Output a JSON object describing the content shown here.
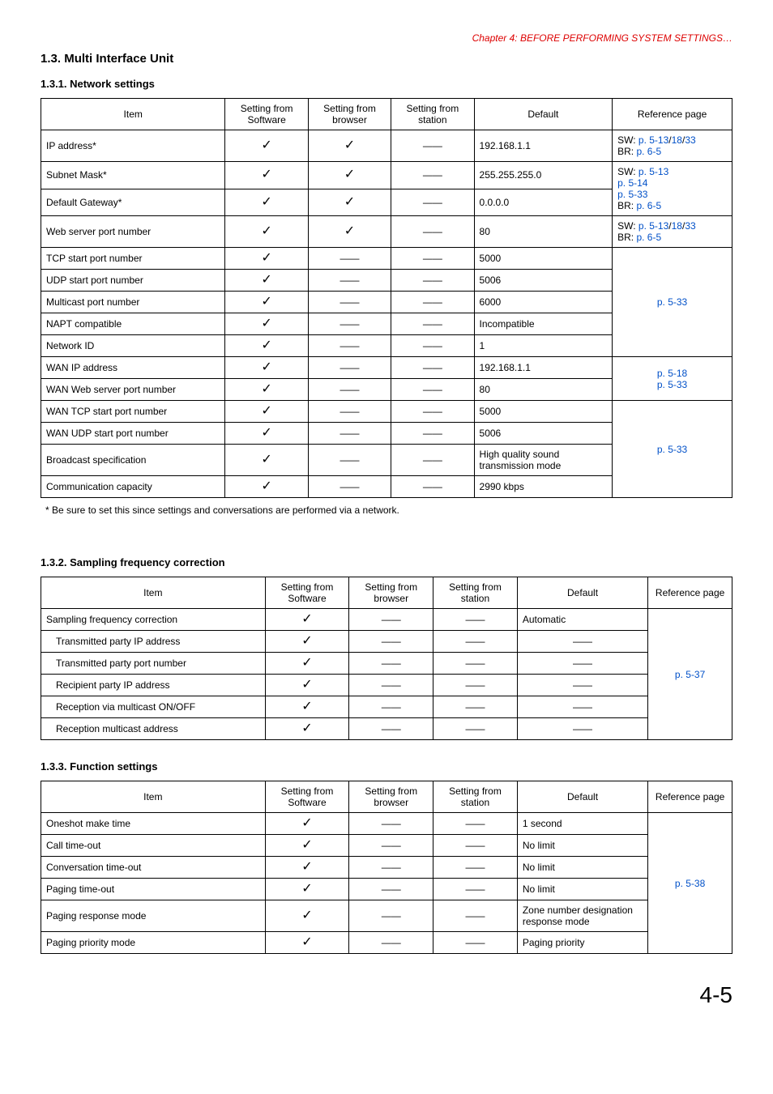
{
  "chapterHeader": "Chapter 4:  BEFORE PERFORMING SYSTEM SETTINGS…",
  "section": {
    "number": "1.3.",
    "title": "Multi Interface Unit"
  },
  "networkSettings": {
    "heading": "1.3.1. Network settings",
    "columns": [
      "Item",
      "Setting from Software",
      "Setting from browser",
      "Setting from station",
      "Default",
      "Reference page"
    ],
    "rows": [
      {
        "item": "IP address*",
        "sw": "✓",
        "br": "✓",
        "st": "——",
        "def": "192.168.1.1",
        "ref": [
          {
            "t": "SW: ",
            "l": false
          },
          {
            "t": "p. 5-13",
            "l": true
          },
          {
            "t": "/",
            "l": false
          },
          {
            "t": "18",
            "l": true
          },
          {
            "t": "/",
            "l": false
          },
          {
            "t": "33",
            "l": true
          },
          {
            "t": "\nBR:  ",
            "l": false
          },
          {
            "t": "p. 6-5",
            "l": true
          }
        ],
        "refRowspan": 1
      },
      {
        "item": "Subnet Mask*",
        "sw": "✓",
        "br": "✓",
        "st": "——",
        "def": "255.255.255.0",
        "ref": [
          {
            "t": "SW: ",
            "l": false
          },
          {
            "t": "p. 5-13",
            "l": true
          },
          {
            "t": "\n",
            "l": false
          },
          {
            "t": "p. 5-14",
            "l": true
          },
          {
            "t": "\n",
            "l": false
          },
          {
            "t": "p. 5-33",
            "l": true
          },
          {
            "t": "\nBR:  ",
            "l": false
          },
          {
            "t": "p. 6-5",
            "l": true
          }
        ],
        "refRowspan": 2
      },
      {
        "item": "Default Gateway*",
        "sw": "✓",
        "br": "✓",
        "st": "——",
        "def": "0.0.0.0"
      },
      {
        "item": "Web server port number",
        "sw": "✓",
        "br": "✓",
        "st": "——",
        "def": "80",
        "ref": [
          {
            "t": "SW: ",
            "l": false
          },
          {
            "t": "p. 5-13",
            "l": true
          },
          {
            "t": "/",
            "l": false
          },
          {
            "t": "18",
            "l": true
          },
          {
            "t": "/",
            "l": false
          },
          {
            "t": "33",
            "l": true
          },
          {
            "t": "\nBR:  ",
            "l": false
          },
          {
            "t": "p. 6-5",
            "l": true
          }
        ],
        "refRowspan": 1
      },
      {
        "item": "TCP start port number",
        "sw": "✓",
        "br": "——",
        "st": "——",
        "def": "5000",
        "ref": [
          {
            "t": "p. 5-33",
            "l": true
          }
        ],
        "refRowspan": 5,
        "refCenter": true
      },
      {
        "item": "UDP start port number",
        "sw": "✓",
        "br": "——",
        "st": "——",
        "def": "5006"
      },
      {
        "item": "Multicast port number",
        "sw": "✓",
        "br": "——",
        "st": "——",
        "def": "6000"
      },
      {
        "item": "NAPT compatible",
        "sw": "✓",
        "br": "——",
        "st": "——",
        "def": "Incompatible"
      },
      {
        "item": "Network ID",
        "sw": "✓",
        "br": "——",
        "st": "——",
        "def": "1"
      },
      {
        "item": "WAN IP address",
        "sw": "✓",
        "br": "——",
        "st": "——",
        "def": "192.168.1.1",
        "ref": [
          {
            "t": "p. 5-18",
            "l": true
          },
          {
            "t": "\n",
            "l": false
          },
          {
            "t": "p. 5-33",
            "l": true
          }
        ],
        "refRowspan": 2,
        "refCenter": true
      },
      {
        "item": "WAN Web server port number",
        "sw": "✓",
        "br": "——",
        "st": "——",
        "def": "80"
      },
      {
        "item": "WAN TCP start port number",
        "sw": "✓",
        "br": "——",
        "st": "——",
        "def": "5000",
        "ref": [
          {
            "t": "p. 5-33",
            "l": true
          }
        ],
        "refRowspan": 4,
        "refCenter": true
      },
      {
        "item": "WAN UDP start port number",
        "sw": "✓",
        "br": "——",
        "st": "——",
        "def": "5006"
      },
      {
        "item": "Broadcast specification",
        "sw": "✓",
        "br": "——",
        "st": "——",
        "def": "High quality sound transmission mode"
      },
      {
        "item": "Communication capacity",
        "sw": "✓",
        "br": "——",
        "st": "——",
        "def": "2990 kbps"
      }
    ],
    "footnote": "*  Be sure to set this since settings and conversations are performed via a network."
  },
  "samplingFreq": {
    "heading": "1.3.2. Sampling frequency correction",
    "columns": [
      "Item",
      "Setting from Software",
      "Setting from browser",
      "Setting from station",
      "Default",
      "Reference page"
    ],
    "rows": [
      {
        "item": "Sampling frequency correction",
        "sw": "✓",
        "br": "——",
        "st": "——",
        "def": "Automatic",
        "indent": false
      },
      {
        "item": "Transmitted party IP address",
        "sw": "✓",
        "br": "——",
        "st": "——",
        "def": "——",
        "indent": true
      },
      {
        "item": "Transmitted party port number",
        "sw": "✓",
        "br": "——",
        "st": "——",
        "def": "——",
        "indent": true
      },
      {
        "item": "Recipient party IP address",
        "sw": "✓",
        "br": "——",
        "st": "——",
        "def": "——",
        "indent": true
      },
      {
        "item": "Reception via multicast ON/OFF",
        "sw": "✓",
        "br": "——",
        "st": "——",
        "def": "——",
        "indent": true
      },
      {
        "item": "Reception multicast address",
        "sw": "✓",
        "br": "——",
        "st": "——",
        "def": "——",
        "indent": true
      }
    ],
    "refText": "p. 5-37"
  },
  "functionSettings": {
    "heading": "1.3.3. Function settings",
    "columns": [
      "Item",
      "Setting from Software",
      "Setting from browser",
      "Setting from station",
      "Default",
      "Reference page"
    ],
    "rows": [
      {
        "item": "Oneshot make time",
        "sw": "✓",
        "br": "——",
        "st": "——",
        "def": "1 second"
      },
      {
        "item": "Call time-out",
        "sw": "✓",
        "br": "——",
        "st": "——",
        "def": "No limit"
      },
      {
        "item": "Conversation time-out",
        "sw": "✓",
        "br": "——",
        "st": "——",
        "def": "No limit"
      },
      {
        "item": "Paging time-out",
        "sw": "✓",
        "br": "——",
        "st": "——",
        "def": "No limit"
      },
      {
        "item": "Paging response mode",
        "sw": "✓",
        "br": "——",
        "st": "——",
        "def": "Zone number designation response mode"
      },
      {
        "item": "Paging priority mode",
        "sw": "✓",
        "br": "——",
        "st": "——",
        "def": "Paging priority"
      }
    ],
    "refText": "p. 5-38"
  },
  "pageNumber": "4-5"
}
